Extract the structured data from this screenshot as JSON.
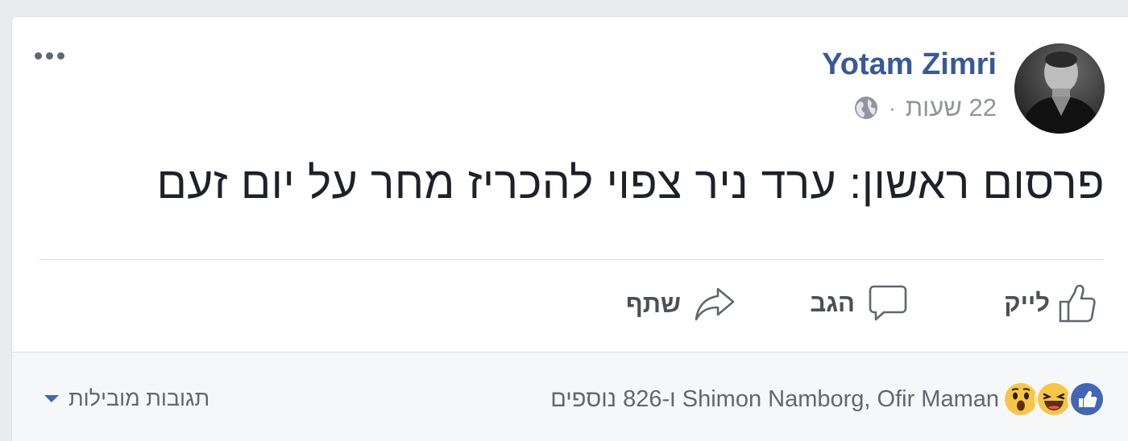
{
  "post": {
    "author": "Yotam Zimri",
    "time": "22 שעות",
    "separator": "·",
    "privacy_icon": "globe-icon",
    "text": "פרסום ראשון: ערד ניר צפוי להכריז מחר על יום זעם"
  },
  "actions": {
    "like_label": "לייק",
    "comment_label": "הגב",
    "share_label": "שתף"
  },
  "footer": {
    "reactions": [
      "like-reaction-icon",
      "haha-reaction-icon",
      "wow-reaction-icon"
    ],
    "names_text": "Shimon Namborg, Ofir Maman ו-826 נוספים",
    "relevant_label": "תגובות מובילות"
  },
  "colors": {
    "author": "#385898",
    "like_blue": "#4267b2",
    "text": "#1d2129",
    "muted": "#90949c"
  }
}
